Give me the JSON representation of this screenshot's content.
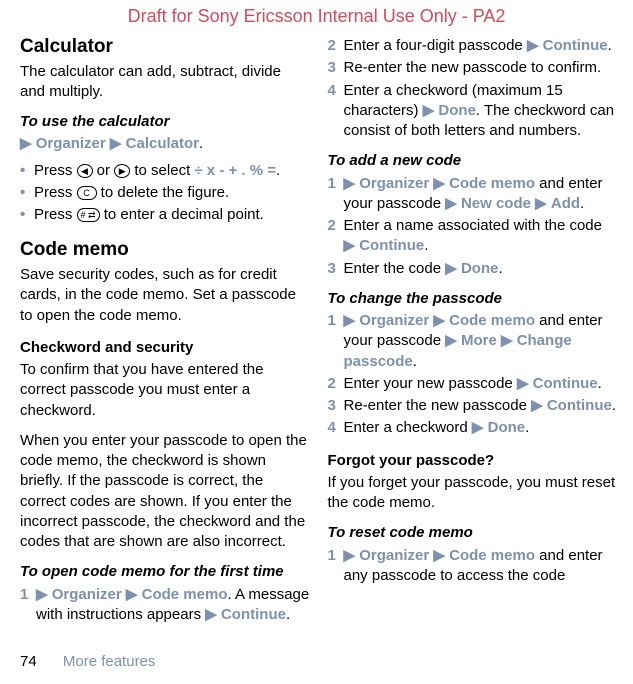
{
  "watermark": "Draft for Sony Ericsson Internal Use Only - PA2",
  "left": {
    "calc_heading": "Calculator",
    "calc_intro": "The calculator can add, subtract, divide and multiply.",
    "calc_sub": "To use the calculator",
    "calc_nav_org": "Organizer",
    "calc_nav_calc": "Calculator",
    "b1_a": "Press ",
    "b1_icon1": "◀",
    "b1_b": " or ",
    "b1_icon2": "▶",
    "b1_c": " to select ",
    "b1_ops": "÷ x - + . % =",
    "b1_d": ".",
    "b2_a": "Press ",
    "b2_icon": "C",
    "b2_b": " to delete the figure.",
    "b3_a": "Press ",
    "b3_icon": "# ⇄",
    "b3_b": " to enter a decimal point.",
    "memo_heading": "Code memo",
    "memo_intro": "Save security codes, such as for credit cards, in the code memo. Set a passcode to open the code memo.",
    "check_sub": "Checkword and security",
    "check_p1": "To confirm that you have entered the correct passcode you must enter a checkword.",
    "check_p2": "When you enter your passcode to open the code memo, the checkword is shown briefly. If the passcode is correct, the correct codes are shown. If you enter the incorrect passcode, the checkword and the codes that are shown are also incorrect.",
    "open_sub": "To open code memo for the first time",
    "open_s1_nav1": "Organizer",
    "open_s1_nav2": "Code memo",
    "open_s1_a": ". A message with instructions appears ",
    "open_s1_cont": "Continue",
    "open_s1_b": "."
  },
  "right": {
    "s2_a": "Enter a four-digit passcode ",
    "s2_cont": "Continue",
    "s2_b": ".",
    "s3": "Re-enter the new passcode to confirm.",
    "s4_a": "Enter a checkword (maximum 15 characters) ",
    "s4_done": "Done",
    "s4_b": ". The checkword can consist of both letters and numbers.",
    "add_sub": "To add a new code",
    "a1_nav1": "Organizer",
    "a1_nav2": "Code memo",
    "a1_mid": " and enter your passcode ",
    "a1_nav3": "New code",
    "a1_nav4": "Add",
    "a1_end": ".",
    "a2_a": "Enter a name associated with the code ",
    "a2_cont": "Continue",
    "a2_b": ".",
    "a3_a": "Enter the code ",
    "a3_done": "Done",
    "a3_b": ".",
    "chg_sub": "To change the passcode",
    "c1_nav1": "Organizer",
    "c1_nav2": "Code memo",
    "c1_mid": " and enter your passcode ",
    "c1_nav3": "More",
    "c1_nav4": "Change passcode",
    "c1_end": ".",
    "c2_a": "Enter your new passcode ",
    "c2_cont": "Continue",
    "c2_b": ".",
    "c3_a": "Re-enter the new passcode ",
    "c3_cont": "Continue",
    "c3_b": ".",
    "c4_a": "Enter a checkword ",
    "c4_done": "Done",
    "c4_b": ".",
    "forgot_sub": "Forgot your passcode?",
    "forgot_p": "If you forget your passcode, you must reset the code memo.",
    "reset_sub": "To reset code memo",
    "r1_nav1": "Organizer",
    "r1_nav2": "Code memo",
    "r1_mid": " and enter any passcode to access the code"
  },
  "nums": {
    "n1": "1",
    "n2": "2",
    "n3": "3",
    "n4": "4"
  },
  "arrow": "▶",
  "footer": {
    "page": "74",
    "section": "More features"
  }
}
